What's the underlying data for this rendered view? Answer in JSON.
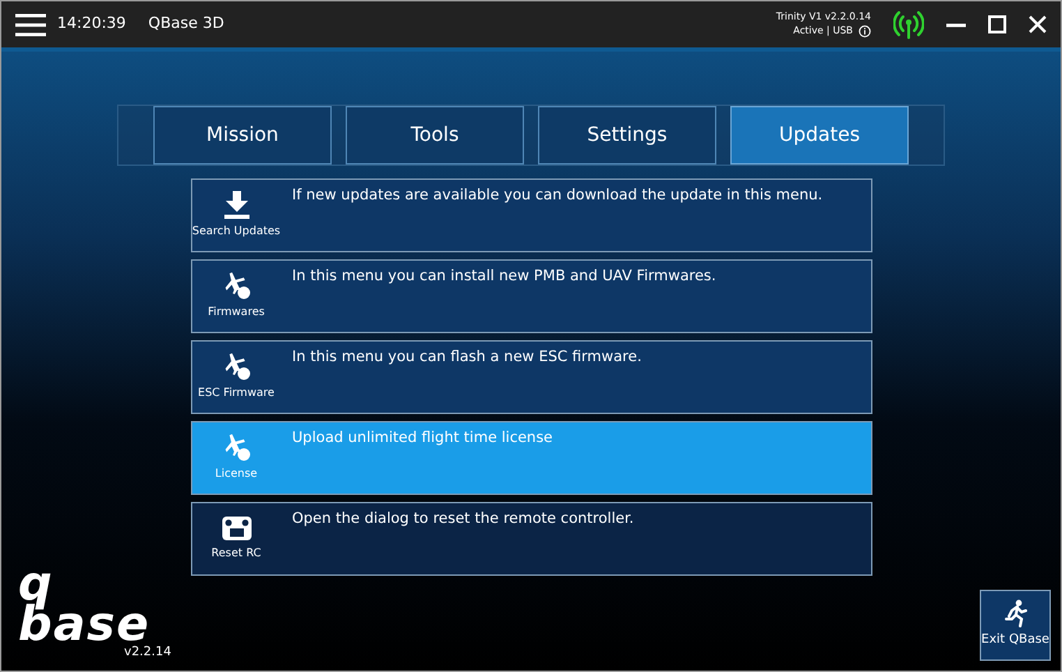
{
  "title_bar": {
    "time": "14:20:39",
    "app_name": "QBase 3D",
    "device_name": "Trinity V1 v2.2.0.14",
    "device_status": "Active | USB"
  },
  "tabs": [
    {
      "label": "Mission",
      "selected": false
    },
    {
      "label": "Tools",
      "selected": false
    },
    {
      "label": "Settings",
      "selected": false
    },
    {
      "label": "Updates",
      "selected": true
    }
  ],
  "menu_items": [
    {
      "kind": "download",
      "label": "Search Updates",
      "description": "If new updates are available you can download the update in this menu.",
      "selected": false
    },
    {
      "kind": "aircraft",
      "label": "Firmwares",
      "description": "In this menu you can install new PMB and UAV Firmwares.",
      "selected": false
    },
    {
      "kind": "aircraft",
      "label": "ESC Firmware",
      "description": "In this menu you can flash a new ESC firmware.",
      "selected": false
    },
    {
      "kind": "aircraft",
      "label": "License",
      "description": "Upload unlimited flight time license",
      "selected": true
    },
    {
      "kind": "remote",
      "label": "Reset RC",
      "description": "Open the dialog to reset the remote controller.",
      "selected": false
    }
  ],
  "logo": {
    "line_1": "q",
    "line_2": "base"
  },
  "version": "v2.2.14",
  "exit_button": {
    "label": "Exit QBase"
  }
}
